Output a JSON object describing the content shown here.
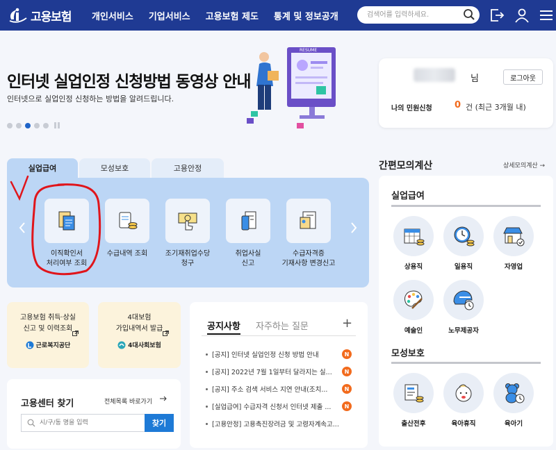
{
  "header": {
    "logo_text": "고용보험",
    "nav": [
      "개인서비스",
      "기업서비스",
      "고용보험 제도",
      "통계 및 정보공개"
    ],
    "search_placeholder": "검색어를 입력하세요."
  },
  "banner": {
    "title": "인터넷 실업인정 신청방법 동영상 안내",
    "subtitle": "인터넷으로 실업인정 신청하는 방법을 알려드립니다.",
    "illustration_label": "RESUME"
  },
  "login": {
    "suffix": "님",
    "logout_label": "로그아웃",
    "civil_label": "나의 민원신청",
    "civil_count": "0",
    "civil_unit": "건 (최근 3개월 내)"
  },
  "tabs": [
    "실업급여",
    "모성보호",
    "고용안정"
  ],
  "services": [
    {
      "label": "이직확인서\n처리여부 조회",
      "icon": "document-icon"
    },
    {
      "label": "수급내역 조회",
      "icon": "scroll-coins-icon"
    },
    {
      "label": "조기재취업수당\n청구",
      "icon": "money-touch-icon"
    },
    {
      "label": "취업사실\n신고",
      "icon": "phone-document-icon"
    },
    {
      "label": "수급자격증\n기재사항 변경신고",
      "icon": "certificate-icon"
    }
  ],
  "quick_cards": [
    {
      "text": "고용보험 취득·상실\n신고 및 이력조회",
      "org": "근로복지공단"
    },
    {
      "text": "4대보험\n가입내역서 발급",
      "org": "4대사회보험"
    }
  ],
  "center": {
    "title": "고용센터 찾기",
    "all_link": "전체목록 바로가기",
    "input_placeholder": "시/구/동 명을 입력",
    "button": "찾기"
  },
  "notice": {
    "tabs": [
      "공지사항",
      "자주하는 질문"
    ],
    "plus": "+",
    "badge": "N",
    "items": [
      {
        "text": "[공지] 인터넷 실업인정 신청 방법 안내",
        "new": true
      },
      {
        "text": "[공지] 2022년 7월 1일부터 달라지는 실...",
        "new": true
      },
      {
        "text": "[공지] 주소 검색 서비스 지연 안내(조치...",
        "new": true
      },
      {
        "text": "[실업급여] 수급자격 신청서 인터넷 제출 ...",
        "new": true
      },
      {
        "text": "[고용안정] 고용촉진장려금 및 고령자계속고...",
        "new": false
      }
    ]
  },
  "calculator": {
    "title": "간편모의계산",
    "detail_link": "상세모의계산",
    "sections": [
      {
        "title": "실업급여",
        "items": [
          {
            "label": "상용직",
            "icon": "calendar-coins-icon"
          },
          {
            "label": "일용직",
            "icon": "clock-coins-icon"
          },
          {
            "label": "자영업",
            "icon": "store-icon"
          },
          {
            "label": "예술인",
            "icon": "palette-icon"
          },
          {
            "label": "노무제공자",
            "icon": "helmet-clock-icon"
          }
        ]
      },
      {
        "title": "모성보호",
        "items": [
          {
            "label": "출산전후",
            "icon": "document-coins-icon"
          },
          {
            "label": "육아휴직",
            "icon": "baby-icon"
          },
          {
            "label": "육아기",
            "icon": "teddy-clock-icon"
          }
        ]
      }
    ]
  },
  "colors": {
    "header": "#1f3a93",
    "tab_panel": "#bcd6f5",
    "accent": "#1e7ad6",
    "badge": "#f26b1d",
    "annotation": "#e0151b"
  }
}
